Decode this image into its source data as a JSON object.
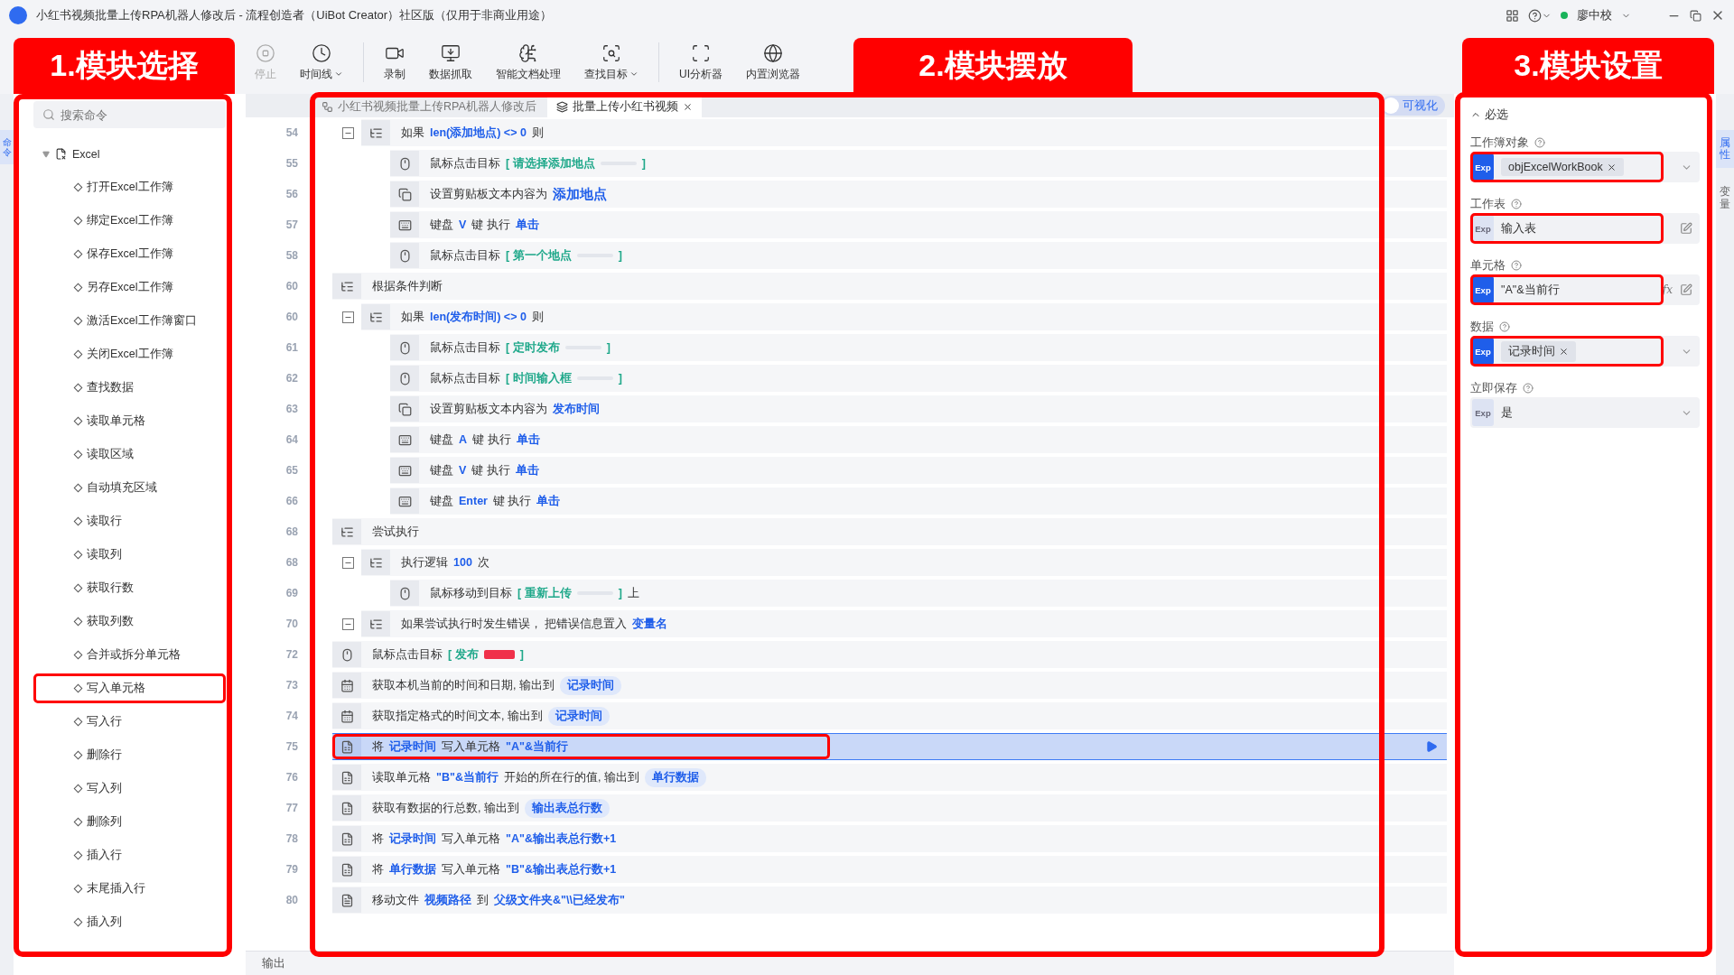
{
  "window": {
    "title": "小红书视频批量上传RPA机器人修改后 - 流程创造者（UiBot Creator）社区版（仅用于非商业用途）",
    "user": "廖中校"
  },
  "toolbar": [
    {
      "label": "停止",
      "disabled": true,
      "menu": false
    },
    {
      "label": "时间线",
      "disabled": false,
      "menu": true
    },
    {
      "label": "录制",
      "disabled": false,
      "menu": false
    },
    {
      "label": "数据抓取",
      "disabled": false,
      "menu": false
    },
    {
      "label": "智能文档处理",
      "disabled": false,
      "menu": false
    },
    {
      "label": "查找目标",
      "disabled": false,
      "menu": true
    },
    {
      "label": "UI分析器",
      "disabled": false,
      "menu": false
    },
    {
      "label": "内置浏览器",
      "disabled": false,
      "menu": false
    }
  ],
  "left_rail": [
    {
      "label": "命令",
      "selected": true
    }
  ],
  "command_panel": {
    "search": {
      "placeholder": "搜索命令"
    },
    "tree": [
      {
        "label": "Excel",
        "expanded": true,
        "children": [
          {
            "label": "打开Excel工作簿",
            "highlighted": false
          },
          {
            "label": "绑定Excel工作簿",
            "highlighted": false
          },
          {
            "label": "保存Excel工作簿",
            "highlighted": false
          },
          {
            "label": "另存Excel工作簿",
            "highlighted": false
          },
          {
            "label": "激活Excel工作簿窗口",
            "highlighted": false
          },
          {
            "label": "关闭Excel工作簿",
            "highlighted": false
          },
          {
            "label": "查找数据",
            "highlighted": false
          },
          {
            "label": "读取单元格",
            "highlighted": false
          },
          {
            "label": "读取区域",
            "highlighted": false
          },
          {
            "label": "自动填充区域",
            "highlighted": false
          },
          {
            "label": "读取行",
            "highlighted": false
          },
          {
            "label": "读取列",
            "highlighted": false
          },
          {
            "label": "获取行数",
            "highlighted": false
          },
          {
            "label": "获取列数",
            "highlighted": false
          },
          {
            "label": "合并或拆分单元格",
            "highlighted": false
          },
          {
            "label": "写入单元格",
            "highlighted": true
          },
          {
            "label": "写入行",
            "highlighted": false
          },
          {
            "label": "删除行",
            "highlighted": false
          },
          {
            "label": "写入列",
            "highlighted": false
          },
          {
            "label": "删除列",
            "highlighted": false
          },
          {
            "label": "插入行",
            "highlighted": false
          },
          {
            "label": "末尾插入行",
            "highlighted": false
          },
          {
            "label": "插入列",
            "highlighted": false
          }
        ]
      }
    ]
  },
  "editor": {
    "tabs": [
      {
        "label": "小红书视频批量上传RPA机器人修改后",
        "selected": false,
        "closable": false
      },
      {
        "label": "批量上传小红书视频",
        "selected": true,
        "closable": true
      }
    ],
    "visualize": {
      "label": "可视化",
      "on": false
    },
    "rows": [
      {
        "kind": "continuation",
        "children": [
          {
            "line": "54",
            "kind": "branch",
            "expanded": true,
            "selected": false,
            "highlighted": false,
            "parts": [
              {
                "kind": "plain",
                "text": "如果"
              },
              {
                "kind": "var",
                "text": "len(添加地点) <> 0"
              },
              {
                "kind": "plain",
                "text": "则"
              }
            ],
            "children": [
              {
                "line": "55",
                "kind": "mouse",
                "selected": false,
                "highlighted": false,
                "parts": [
                  {
                    "kind": "plain",
                    "text": "鼠标点击目标"
                  },
                  {
                    "kind": "target",
                    "text": "[ 请选择添加地点"
                  },
                  {
                    "kind": "thumb"
                  },
                  {
                    "kind": "target",
                    "text": "]"
                  }
                ]
              },
              {
                "line": "56",
                "kind": "clipboard",
                "selected": false,
                "highlighted": false,
                "parts": [
                  {
                    "kind": "plain",
                    "text": "设置剪贴板文本内容为"
                  },
                  {
                    "kind": "big",
                    "text": "添加地点"
                  }
                ]
              },
              {
                "line": "57",
                "kind": "keyboard",
                "selected": false,
                "highlighted": false,
                "parts": [
                  {
                    "kind": "plain",
                    "text": "键盘"
                  },
                  {
                    "kind": "var",
                    "text": "V"
                  },
                  {
                    "kind": "plain",
                    "text": "键 执行"
                  },
                  {
                    "kind": "var",
                    "text": "单击"
                  }
                ]
              },
              {
                "line": "58",
                "kind": "mouse",
                "selected": false,
                "highlighted": false,
                "parts": [
                  {
                    "kind": "plain",
                    "text": "鼠标点击目标"
                  },
                  {
                    "kind": "target",
                    "text": "[ 第一个地点"
                  },
                  {
                    "kind": "thumb"
                  },
                  {
                    "kind": "target",
                    "text": "]"
                  }
                ]
              }
            ]
          }
        ]
      },
      {
        "line": "60",
        "kind": "branch",
        "selected": false,
        "highlighted": false,
        "parts": [
          {
            "kind": "plain",
            "text": "根据条件判断"
          }
        ],
        "children": [
          {
            "line": "60",
            "kind": "branch",
            "expanded": true,
            "selected": false,
            "highlighted": false,
            "parts": [
              {
                "kind": "plain",
                "text": "如果"
              },
              {
                "kind": "var",
                "text": "len(发布时间) <> 0"
              },
              {
                "kind": "plain",
                "text": "则"
              }
            ],
            "children": [
              {
                "line": "61",
                "kind": "mouse",
                "selected": false,
                "highlighted": false,
                "parts": [
                  {
                    "kind": "plain",
                    "text": "鼠标点击目标"
                  },
                  {
                    "kind": "target",
                    "text": "[ 定时发布"
                  },
                  {
                    "kind": "thumb"
                  },
                  {
                    "kind": "target",
                    "text": "]"
                  }
                ]
              },
              {
                "line": "62",
                "kind": "mouse",
                "selected": false,
                "highlighted": false,
                "parts": [
                  {
                    "kind": "plain",
                    "text": "鼠标点击目标"
                  },
                  {
                    "kind": "target",
                    "text": "[ 时间输入框"
                  },
                  {
                    "kind": "thumb"
                  },
                  {
                    "kind": "target",
                    "text": "]"
                  }
                ]
              },
              {
                "line": "63",
                "kind": "clipboard",
                "selected": false,
                "highlighted": false,
                "parts": [
                  {
                    "kind": "plain",
                    "text": "设置剪贴板文本内容为"
                  },
                  {
                    "kind": "var",
                    "text": "发布时间"
                  }
                ]
              },
              {
                "line": "64",
                "kind": "keyboard",
                "selected": false,
                "highlighted": false,
                "parts": [
                  {
                    "kind": "plain",
                    "text": "键盘"
                  },
                  {
                    "kind": "var",
                    "text": "A"
                  },
                  {
                    "kind": "plain",
                    "text": "键 执行"
                  },
                  {
                    "kind": "var",
                    "text": "单击"
                  }
                ]
              },
              {
                "line": "65",
                "kind": "keyboard",
                "selected": false,
                "highlighted": false,
                "parts": [
                  {
                    "kind": "plain",
                    "text": "键盘"
                  },
                  {
                    "kind": "var",
                    "text": "V"
                  },
                  {
                    "kind": "plain",
                    "text": "键 执行"
                  },
                  {
                    "kind": "var",
                    "text": "单击"
                  }
                ]
              },
              {
                "line": "66",
                "kind": "keyboard",
                "selected": false,
                "highlighted": false,
                "parts": [
                  {
                    "kind": "plain",
                    "text": "键盘"
                  },
                  {
                    "kind": "var",
                    "text": "Enter"
                  },
                  {
                    "kind": "plain",
                    "text": "键 执行"
                  },
                  {
                    "kind": "var",
                    "text": "单击"
                  }
                ]
              }
            ]
          }
        ]
      },
      {
        "line": "68",
        "kind": "branch",
        "selected": false,
        "highlighted": false,
        "parts": [
          {
            "kind": "plain",
            "text": "尝试执行"
          }
        ],
        "children": [
          {
            "line": "68",
            "kind": "branch",
            "expanded": true,
            "selected": false,
            "highlighted": false,
            "parts": [
              {
                "kind": "plain",
                "text": "执行逻辑"
              },
              {
                "kind": "var",
                "text": "100"
              },
              {
                "kind": "plain",
                "text": "次"
              }
            ],
            "children": [
              {
                "line": "69",
                "kind": "mouse",
                "selected": false,
                "highlighted": false,
                "parts": [
                  {
                    "kind": "plain",
                    "text": "鼠标移动到目标"
                  },
                  {
                    "kind": "target",
                    "text": "[ 重新上传"
                  },
                  {
                    "kind": "thumb"
                  },
                  {
                    "kind": "target",
                    "text": "]"
                  },
                  {
                    "kind": "plain",
                    "text": "上"
                  }
                ]
              }
            ]
          },
          {
            "line": "70",
            "kind": "branch",
            "expanded": true,
            "selected": false,
            "highlighted": false,
            "parts": [
              {
                "kind": "plain",
                "text": "如果尝试执行时发生错误， 把错误信息置入"
              },
              {
                "kind": "var",
                "text": "变量名"
              }
            ]
          }
        ]
      },
      {
        "line": "72",
        "kind": "mouse",
        "selected": false,
        "highlighted": false,
        "parts": [
          {
            "kind": "plain",
            "text": "鼠标点击目标"
          },
          {
            "kind": "target",
            "text": "[ 发布"
          },
          {
            "kind": "thumb-red"
          },
          {
            "kind": "target",
            "text": "]"
          }
        ]
      },
      {
        "line": "73",
        "kind": "calendar",
        "selected": false,
        "highlighted": false,
        "parts": [
          {
            "kind": "plain",
            "text": "获取本机当前的时间和日期, 输出到"
          },
          {
            "kind": "pill",
            "text": "记录时间"
          }
        ]
      },
      {
        "line": "74",
        "kind": "calendar",
        "selected": false,
        "highlighted": false,
        "parts": [
          {
            "kind": "plain",
            "text": "获取指定格式的时间文本, 输出到"
          },
          {
            "kind": "pill",
            "text": "记录时间"
          }
        ]
      },
      {
        "line": "75",
        "kind": "excel",
        "selected": true,
        "highlighted": true,
        "parts": [
          {
            "kind": "plain",
            "text": "将"
          },
          {
            "kind": "var",
            "text": "记录时间"
          },
          {
            "kind": "plain",
            "text": "写入单元格"
          },
          {
            "kind": "var",
            "text": "\"A\"&当前行"
          }
        ]
      },
      {
        "line": "76",
        "kind": "excel",
        "selected": false,
        "highlighted": false,
        "parts": [
          {
            "kind": "plain",
            "text": "读取单元格"
          },
          {
            "kind": "var",
            "text": "\"B\"&当前行"
          },
          {
            "kind": "plain",
            "text": "开始的所在行的值, 输出到"
          },
          {
            "kind": "pill",
            "text": "单行数据"
          }
        ]
      },
      {
        "line": "77",
        "kind": "excel",
        "selected": false,
        "highlighted": false,
        "parts": [
          {
            "kind": "plain",
            "text": "获取有数据的行总数, 输出到"
          },
          {
            "kind": "pill",
            "text": "输出表总行数"
          }
        ]
      },
      {
        "line": "78",
        "kind": "excel",
        "selected": false,
        "highlighted": false,
        "parts": [
          {
            "kind": "plain",
            "text": "将"
          },
          {
            "kind": "var",
            "text": "记录时间"
          },
          {
            "kind": "plain",
            "text": "写入单元格"
          },
          {
            "kind": "var",
            "text": "\"A\"&输出表总行数+1"
          }
        ]
      },
      {
        "line": "79",
        "kind": "excel",
        "selected": false,
        "highlighted": false,
        "parts": [
          {
            "kind": "plain",
            "text": "将"
          },
          {
            "kind": "var",
            "text": "单行数据"
          },
          {
            "kind": "plain",
            "text": "写入单元格"
          },
          {
            "kind": "var",
            "text": "\"B\"&输出表总行数+1"
          }
        ]
      },
      {
        "line": "80",
        "kind": "file",
        "selected": false,
        "highlighted": false,
        "parts": [
          {
            "kind": "plain",
            "text": "移动文件"
          },
          {
            "kind": "var",
            "text": "视频路径"
          },
          {
            "kind": "plain",
            "text": "到"
          },
          {
            "kind": "var",
            "text": "父级文件夹&\"\\\\已经发布\""
          }
        ]
      }
    ],
    "output_tab": "输出"
  },
  "properties": {
    "section": {
      "label": "必选",
      "expanded": true
    },
    "fields": [
      {
        "label": "工作簿对象",
        "badge": "Exp",
        "expression": true,
        "kind": "tag-dropdown",
        "value": "objExcelWorkBook",
        "highlighted": true
      },
      {
        "label": "工作表",
        "badge": "Exp",
        "expression": false,
        "kind": "text-edit",
        "value": "输入表",
        "highlighted": true
      },
      {
        "label": "单元格",
        "badge": "Exp",
        "expression": true,
        "kind": "text-formula",
        "value": "\"A\"&当前行",
        "formula_button": "fx",
        "highlighted": true
      },
      {
        "label": "数据",
        "badge": "Exp",
        "expression": true,
        "kind": "tag-dropdown",
        "value": "记录时间",
        "highlighted": true
      },
      {
        "label": "立即保存",
        "badge": "Exp",
        "expression": false,
        "kind": "text-dropdown",
        "value": "是",
        "highlighted": false
      }
    ]
  },
  "right_rail": [
    {
      "label": "属性",
      "selected": true
    },
    {
      "label": "变量",
      "selected": false
    }
  ],
  "callouts": [
    {
      "label": "1.模块选择"
    },
    {
      "label": "2.模块摆放"
    },
    {
      "label": "3.模块设置"
    }
  ]
}
